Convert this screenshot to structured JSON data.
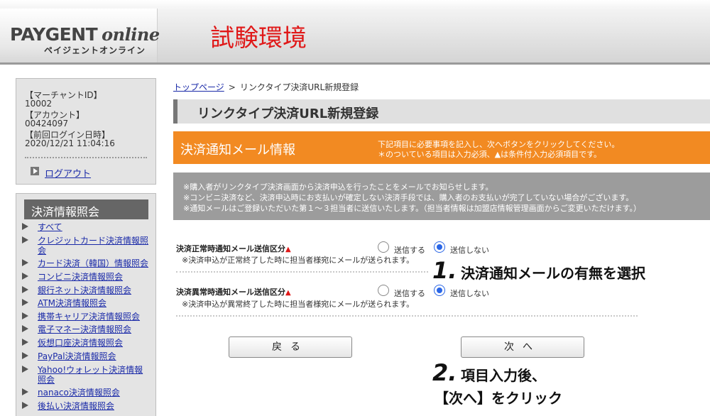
{
  "header": {
    "logo_main": "PAYGENT",
    "logo_online": "online",
    "logo_sub": "ペイジェントオンライン",
    "env_title": "試験環境"
  },
  "account_box": {
    "merchant_id_label": "【マーチャントID】",
    "merchant_id": "10002",
    "account_label": "【アカウント】",
    "account": "00424097",
    "last_login_label": "【前回ログイン日時】",
    "last_login": "2020/12/21 11:04:16",
    "logout": "ログアウト"
  },
  "menu": {
    "title": "決済情報照会",
    "items": [
      "すべて",
      "クレジットカード決済情報照会",
      "カード決済（韓国）情報照会",
      "コンビニ決済情報照会",
      "銀行ネット決済情報照会",
      "ATM決済情報照会",
      "携帯キャリア決済情報照会",
      "電子マネー決済情報照会",
      "仮想口座決済情報照会",
      "PayPal決済情報照会",
      "Yahoo!ウォレット決済情報照会",
      "nanaco決済情報照会",
      "後払い決済情報照会"
    ]
  },
  "breadcrumb": {
    "home": "トップページ",
    "sep": ">",
    "current": "リンクタイプ決済URL新規登録"
  },
  "page_title": "リンクタイプ決済URL新規登録",
  "section": {
    "title": "決済通知メール情報",
    "note1": "下記項目に必要事項を記入し、次へボタンをクリックしてください。",
    "note2": "＊のついている項目は入力必須、▲は条件付入力必須項目です。"
  },
  "notice": [
    "※購入者がリンクタイプ決済画面から決済申込を行ったことをメールでお知らせします。",
    "※コンビニ決済など、決済申込時にお支払いが確定しない決済手段では、購入者のお支払いが完了していない場合がございます。",
    "※通知メールはご登録いただいた第１～３担当者に送信いたします。（担当者情報は加盟店情報管理画面からご変更いただけます。）"
  ],
  "fields": [
    {
      "label": "決済正常時通知メール送信区分",
      "warn": "▲",
      "note": "※決済申込が正常終了した時に担当者様宛にメールが送られます。",
      "option_send": "送信する",
      "option_nosend": "送信しない",
      "selected": "送信しない"
    },
    {
      "label": "決済異常時通知メール送信区分",
      "warn": "▲",
      "note": "※決済申込が異常終了した時に担当者様宛にメールが送られます。",
      "option_send": "送信する",
      "option_nosend": "送信しない",
      "selected": "送信しない"
    }
  ],
  "buttons": {
    "back": "戻る",
    "next": "次へ"
  },
  "annotations": {
    "step1_num": "1.",
    "step1_text": "決済通知メールの有無を選択",
    "step2_num": "2.",
    "step2_text_line1": "項目入力後、",
    "step2_text_line2": "【次へ】をクリック"
  },
  "colors": {
    "env_red": "#e01818",
    "orange": "#f28a22",
    "link_blue": "#1a2aa8",
    "radio_blue": "#2a66e6"
  }
}
